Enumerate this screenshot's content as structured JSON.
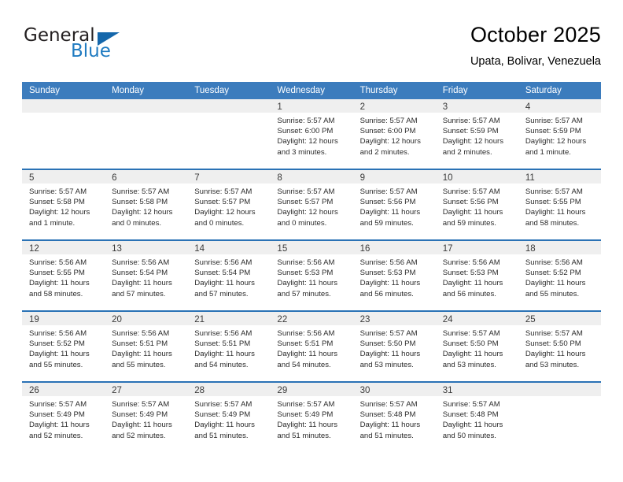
{
  "logo": {
    "primary_text": "General",
    "secondary_text": "Blue",
    "triangle_color": "#1567ab",
    "secondary_color": "#1f7bc1"
  },
  "header": {
    "title": "October 2025",
    "location": "Upata, Bolivar, Venezuela"
  },
  "theme": {
    "header_blue": "#3c7cbd",
    "row_divider_blue": "#2a72b5",
    "day_band_gray": "#efefef"
  },
  "calendar": {
    "weekdays": [
      "Sunday",
      "Monday",
      "Tuesday",
      "Wednesday",
      "Thursday",
      "Friday",
      "Saturday"
    ],
    "weeks": [
      [
        {
          "day": "",
          "lines": []
        },
        {
          "day": "",
          "lines": []
        },
        {
          "day": "",
          "lines": []
        },
        {
          "day": "1",
          "lines": [
            "Sunrise: 5:57 AM",
            "Sunset: 6:00 PM",
            "Daylight: 12 hours",
            "and 3 minutes."
          ]
        },
        {
          "day": "2",
          "lines": [
            "Sunrise: 5:57 AM",
            "Sunset: 6:00 PM",
            "Daylight: 12 hours",
            "and 2 minutes."
          ]
        },
        {
          "day": "3",
          "lines": [
            "Sunrise: 5:57 AM",
            "Sunset: 5:59 PM",
            "Daylight: 12 hours",
            "and 2 minutes."
          ]
        },
        {
          "day": "4",
          "lines": [
            "Sunrise: 5:57 AM",
            "Sunset: 5:59 PM",
            "Daylight: 12 hours",
            "and 1 minute."
          ]
        }
      ],
      [
        {
          "day": "5",
          "lines": [
            "Sunrise: 5:57 AM",
            "Sunset: 5:58 PM",
            "Daylight: 12 hours",
            "and 1 minute."
          ]
        },
        {
          "day": "6",
          "lines": [
            "Sunrise: 5:57 AM",
            "Sunset: 5:58 PM",
            "Daylight: 12 hours",
            "and 0 minutes."
          ]
        },
        {
          "day": "7",
          "lines": [
            "Sunrise: 5:57 AM",
            "Sunset: 5:57 PM",
            "Daylight: 12 hours",
            "and 0 minutes."
          ]
        },
        {
          "day": "8",
          "lines": [
            "Sunrise: 5:57 AM",
            "Sunset: 5:57 PM",
            "Daylight: 12 hours",
            "and 0 minutes."
          ]
        },
        {
          "day": "9",
          "lines": [
            "Sunrise: 5:57 AM",
            "Sunset: 5:56 PM",
            "Daylight: 11 hours",
            "and 59 minutes."
          ]
        },
        {
          "day": "10",
          "lines": [
            "Sunrise: 5:57 AM",
            "Sunset: 5:56 PM",
            "Daylight: 11 hours",
            "and 59 minutes."
          ]
        },
        {
          "day": "11",
          "lines": [
            "Sunrise: 5:57 AM",
            "Sunset: 5:55 PM",
            "Daylight: 11 hours",
            "and 58 minutes."
          ]
        }
      ],
      [
        {
          "day": "12",
          "lines": [
            "Sunrise: 5:56 AM",
            "Sunset: 5:55 PM",
            "Daylight: 11 hours",
            "and 58 minutes."
          ]
        },
        {
          "day": "13",
          "lines": [
            "Sunrise: 5:56 AM",
            "Sunset: 5:54 PM",
            "Daylight: 11 hours",
            "and 57 minutes."
          ]
        },
        {
          "day": "14",
          "lines": [
            "Sunrise: 5:56 AM",
            "Sunset: 5:54 PM",
            "Daylight: 11 hours",
            "and 57 minutes."
          ]
        },
        {
          "day": "15",
          "lines": [
            "Sunrise: 5:56 AM",
            "Sunset: 5:53 PM",
            "Daylight: 11 hours",
            "and 57 minutes."
          ]
        },
        {
          "day": "16",
          "lines": [
            "Sunrise: 5:56 AM",
            "Sunset: 5:53 PM",
            "Daylight: 11 hours",
            "and 56 minutes."
          ]
        },
        {
          "day": "17",
          "lines": [
            "Sunrise: 5:56 AM",
            "Sunset: 5:53 PM",
            "Daylight: 11 hours",
            "and 56 minutes."
          ]
        },
        {
          "day": "18",
          "lines": [
            "Sunrise: 5:56 AM",
            "Sunset: 5:52 PM",
            "Daylight: 11 hours",
            "and 55 minutes."
          ]
        }
      ],
      [
        {
          "day": "19",
          "lines": [
            "Sunrise: 5:56 AM",
            "Sunset: 5:52 PM",
            "Daylight: 11 hours",
            "and 55 minutes."
          ]
        },
        {
          "day": "20",
          "lines": [
            "Sunrise: 5:56 AM",
            "Sunset: 5:51 PM",
            "Daylight: 11 hours",
            "and 55 minutes."
          ]
        },
        {
          "day": "21",
          "lines": [
            "Sunrise: 5:56 AM",
            "Sunset: 5:51 PM",
            "Daylight: 11 hours",
            "and 54 minutes."
          ]
        },
        {
          "day": "22",
          "lines": [
            "Sunrise: 5:56 AM",
            "Sunset: 5:51 PM",
            "Daylight: 11 hours",
            "and 54 minutes."
          ]
        },
        {
          "day": "23",
          "lines": [
            "Sunrise: 5:57 AM",
            "Sunset: 5:50 PM",
            "Daylight: 11 hours",
            "and 53 minutes."
          ]
        },
        {
          "day": "24",
          "lines": [
            "Sunrise: 5:57 AM",
            "Sunset: 5:50 PM",
            "Daylight: 11 hours",
            "and 53 minutes."
          ]
        },
        {
          "day": "25",
          "lines": [
            "Sunrise: 5:57 AM",
            "Sunset: 5:50 PM",
            "Daylight: 11 hours",
            "and 53 minutes."
          ]
        }
      ],
      [
        {
          "day": "26",
          "lines": [
            "Sunrise: 5:57 AM",
            "Sunset: 5:49 PM",
            "Daylight: 11 hours",
            "and 52 minutes."
          ]
        },
        {
          "day": "27",
          "lines": [
            "Sunrise: 5:57 AM",
            "Sunset: 5:49 PM",
            "Daylight: 11 hours",
            "and 52 minutes."
          ]
        },
        {
          "day": "28",
          "lines": [
            "Sunrise: 5:57 AM",
            "Sunset: 5:49 PM",
            "Daylight: 11 hours",
            "and 51 minutes."
          ]
        },
        {
          "day": "29",
          "lines": [
            "Sunrise: 5:57 AM",
            "Sunset: 5:49 PM",
            "Daylight: 11 hours",
            "and 51 minutes."
          ]
        },
        {
          "day": "30",
          "lines": [
            "Sunrise: 5:57 AM",
            "Sunset: 5:48 PM",
            "Daylight: 11 hours",
            "and 51 minutes."
          ]
        },
        {
          "day": "31",
          "lines": [
            "Sunrise: 5:57 AM",
            "Sunset: 5:48 PM",
            "Daylight: 11 hours",
            "and 50 minutes."
          ]
        },
        {
          "day": "",
          "lines": []
        }
      ]
    ]
  }
}
